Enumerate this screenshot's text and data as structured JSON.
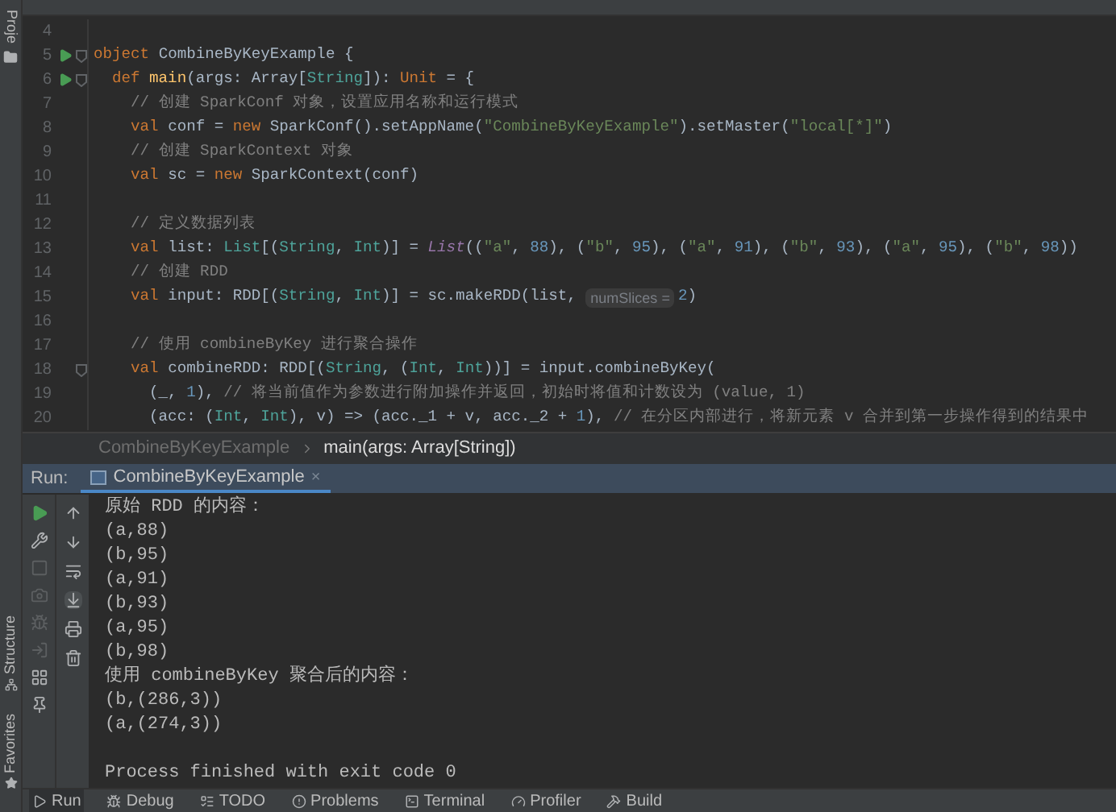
{
  "side_stripe": {
    "top": "Proje",
    "bottom": [
      {
        "label": "Structure"
      },
      {
        "label": "Favorites"
      }
    ]
  },
  "editor": {
    "lines": [
      {
        "number": "4",
        "run": false,
        "fold": false
      },
      {
        "number": "5",
        "run": true,
        "fold": true,
        "segments": [
          {
            "kind": "kw",
            "text": "object "
          },
          {
            "kind": "plain",
            "text": "CombineByKeyExample {"
          }
        ]
      },
      {
        "number": "6",
        "run": true,
        "fold": true,
        "segments": [
          {
            "kind": "kw",
            "text": "  def "
          },
          {
            "kind": "fn",
            "text": "main"
          },
          {
            "kind": "plain",
            "text": "(args: Array["
          },
          {
            "kind": "type",
            "text": "String"
          },
          {
            "kind": "plain",
            "text": "]): "
          },
          {
            "kind": "kw",
            "text": "Unit"
          },
          {
            "kind": "plain",
            "text": " = {"
          }
        ]
      },
      {
        "number": "7",
        "run": false,
        "fold": false,
        "segments": [
          {
            "kind": "cmt",
            "text": "    // 创建 SparkConf 对象，设置应用名称和运行模式"
          }
        ]
      },
      {
        "number": "8",
        "run": false,
        "fold": false,
        "segments": [
          {
            "kind": "kw",
            "text": "    val "
          },
          {
            "kind": "plain",
            "text": "conf = "
          },
          {
            "kind": "kw",
            "text": "new "
          },
          {
            "kind": "plain",
            "text": "SparkConf().setAppName("
          },
          {
            "kind": "str",
            "text": "\"CombineByKeyExample\""
          },
          {
            "kind": "plain",
            "text": ").setMaster("
          },
          {
            "kind": "str",
            "text": "\"local[*]\""
          },
          {
            "kind": "plain",
            "text": ")"
          }
        ]
      },
      {
        "number": "9",
        "run": false,
        "fold": false,
        "segments": [
          {
            "kind": "cmt",
            "text": "    // 创建 SparkContext 对象"
          }
        ]
      },
      {
        "number": "10",
        "run": false,
        "fold": false,
        "segments": [
          {
            "kind": "kw",
            "text": "    val "
          },
          {
            "kind": "plain",
            "text": "sc = "
          },
          {
            "kind": "kw",
            "text": "new "
          },
          {
            "kind": "plain",
            "text": "SparkContext(conf)"
          }
        ]
      },
      {
        "number": "11",
        "run": false,
        "fold": false
      },
      {
        "number": "12",
        "run": false,
        "fold": false,
        "segments": [
          {
            "kind": "cmt",
            "text": "    // 定义数据列表"
          }
        ]
      },
      {
        "number": "13",
        "run": false,
        "fold": false,
        "segments": [
          {
            "kind": "kw",
            "text": "    val "
          },
          {
            "kind": "plain",
            "text": "list: "
          },
          {
            "kind": "type",
            "text": "List"
          },
          {
            "kind": "plain",
            "text": "[("
          },
          {
            "kind": "type",
            "text": "String"
          },
          {
            "kind": "plain",
            "text": ", "
          },
          {
            "kind": "type",
            "text": "Int"
          },
          {
            "kind": "plain",
            "text": ")] = "
          },
          {
            "kind": "italic",
            "text": "List"
          },
          {
            "kind": "plain",
            "text": "(("
          },
          {
            "kind": "str",
            "text": "\"a\""
          },
          {
            "kind": "plain",
            "text": ", "
          },
          {
            "kind": "num",
            "text": "88"
          },
          {
            "kind": "plain",
            "text": "), ("
          },
          {
            "kind": "str",
            "text": "\"b\""
          },
          {
            "kind": "plain",
            "text": ", "
          },
          {
            "kind": "num",
            "text": "95"
          },
          {
            "kind": "plain",
            "text": "), ("
          },
          {
            "kind": "str",
            "text": "\"a\""
          },
          {
            "kind": "plain",
            "text": ", "
          },
          {
            "kind": "num",
            "text": "91"
          },
          {
            "kind": "plain",
            "text": "), ("
          },
          {
            "kind": "str",
            "text": "\"b\""
          },
          {
            "kind": "plain",
            "text": ", "
          },
          {
            "kind": "num",
            "text": "93"
          },
          {
            "kind": "plain",
            "text": "), ("
          },
          {
            "kind": "str",
            "text": "\"a\""
          },
          {
            "kind": "plain",
            "text": ", "
          },
          {
            "kind": "num",
            "text": "95"
          },
          {
            "kind": "plain",
            "text": "), ("
          },
          {
            "kind": "str",
            "text": "\"b\""
          },
          {
            "kind": "plain",
            "text": ", "
          },
          {
            "kind": "num",
            "text": "98"
          },
          {
            "kind": "plain",
            "text": "))"
          }
        ]
      },
      {
        "number": "14",
        "run": false,
        "fold": false,
        "segments": [
          {
            "kind": "cmt",
            "text": "    // 创建 RDD"
          }
        ]
      },
      {
        "number": "15",
        "run": false,
        "fold": false,
        "segments": [
          {
            "kind": "kw",
            "text": "    val "
          },
          {
            "kind": "plain",
            "text": "input: RDD[("
          },
          {
            "kind": "type",
            "text": "String"
          },
          {
            "kind": "plain",
            "text": ", "
          },
          {
            "kind": "type",
            "text": "Int"
          },
          {
            "kind": "plain",
            "text": ")] = sc.makeRDD(list, "
          },
          {
            "kind": "hint",
            "text": "numSlices ="
          },
          {
            "kind": "num",
            "text": "2"
          },
          {
            "kind": "plain",
            "text": ")"
          }
        ]
      },
      {
        "number": "16",
        "run": false,
        "fold": false
      },
      {
        "number": "17",
        "run": false,
        "fold": false,
        "segments": [
          {
            "kind": "cmt",
            "text": "    // 使用 combineByKey 进行聚合操作"
          }
        ]
      },
      {
        "number": "18",
        "run": false,
        "fold": true,
        "segments": [
          {
            "kind": "kw",
            "text": "    val "
          },
          {
            "kind": "plain",
            "text": "combineRDD: RDD[("
          },
          {
            "kind": "type",
            "text": "String"
          },
          {
            "kind": "plain",
            "text": ", ("
          },
          {
            "kind": "type",
            "text": "Int"
          },
          {
            "kind": "plain",
            "text": ", "
          },
          {
            "kind": "type",
            "text": "Int"
          },
          {
            "kind": "plain",
            "text": "))] = input.combineByKey("
          }
        ]
      },
      {
        "number": "19",
        "run": false,
        "fold": false,
        "segments": [
          {
            "kind": "plain",
            "text": "      (_, "
          },
          {
            "kind": "num",
            "text": "1"
          },
          {
            "kind": "plain",
            "text": "), "
          },
          {
            "kind": "cmt",
            "text": "// 将当前值作为参数进行附加操作并返回，初始时将值和计数设为 (value, 1)"
          }
        ]
      },
      {
        "number": "20",
        "run": false,
        "fold": false,
        "segments": [
          {
            "kind": "plain",
            "text": "      (acc: ("
          },
          {
            "kind": "type",
            "text": "Int"
          },
          {
            "kind": "plain",
            "text": ", "
          },
          {
            "kind": "type",
            "text": "Int"
          },
          {
            "kind": "plain",
            "text": "), v) => (acc._1 + v, acc._2 + "
          },
          {
            "kind": "num",
            "text": "1"
          },
          {
            "kind": "plain",
            "text": "), "
          },
          {
            "kind": "cmt",
            "text": "// 在分区内部进行，将新元素 v 合并到第一步操作得到的结果中"
          }
        ]
      }
    ]
  },
  "breadcrumb": [
    {
      "label": "CombineByKeyExample",
      "current": false
    },
    {
      "label": "main(args: Array[String])",
      "current": true
    }
  ],
  "run_panel": {
    "title": "Run:",
    "tabs": [
      {
        "label": "CombineByKeyExample",
        "selected": true,
        "close": "×"
      }
    ],
    "console": [
      {
        "kind": "output",
        "text": "原始 RDD 的内容："
      },
      {
        "kind": "output",
        "text": "(a,88)"
      },
      {
        "kind": "output",
        "text": "(b,95)"
      },
      {
        "kind": "output",
        "text": "(a,91)"
      },
      {
        "kind": "output",
        "text": "(b,93)"
      },
      {
        "kind": "output",
        "text": "(a,95)"
      },
      {
        "kind": "output",
        "text": "(b,98)"
      },
      {
        "kind": "output",
        "text": "使用 combineByKey 聚合后的内容："
      },
      {
        "kind": "output",
        "text": "(b,(286,3))"
      },
      {
        "kind": "output",
        "text": "(a,(274,3))"
      },
      {
        "kind": "status",
        "text": "Process finished with exit code 0"
      }
    ]
  },
  "tool_windows": [
    {
      "label": "Run",
      "selected": true
    },
    {
      "label": "Debug",
      "selected": false
    },
    {
      "label": "TODO",
      "selected": false
    },
    {
      "label": "Problems",
      "selected": false
    },
    {
      "label": "Terminal",
      "selected": false
    },
    {
      "label": "Profiler",
      "selected": false
    },
    {
      "label": "Build",
      "selected": false
    }
  ]
}
